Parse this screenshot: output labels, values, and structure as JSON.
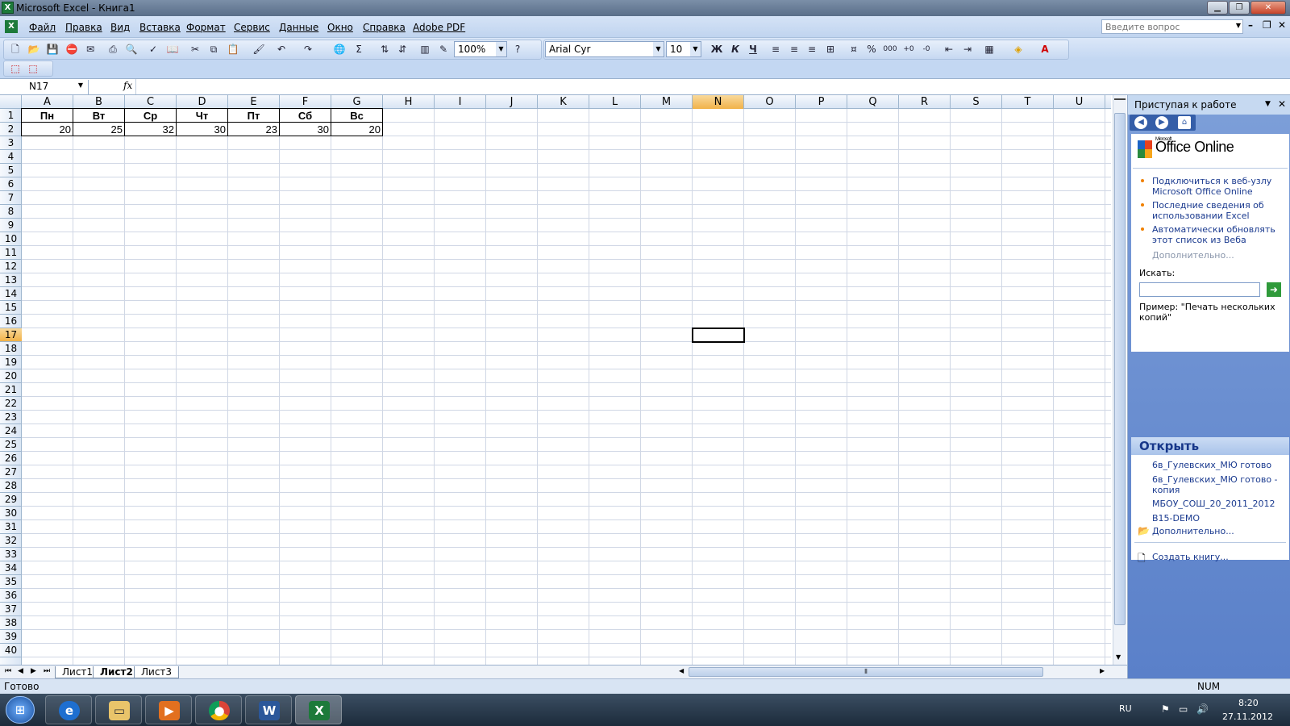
{
  "window": {
    "title": "Microsoft Excel - Книга1"
  },
  "menu": {
    "items": [
      "Файл",
      "Правка",
      "Вид",
      "Вставка",
      "Формат",
      "Сервис",
      "Данные",
      "Окно",
      "Справка",
      "Adobe PDF"
    ],
    "ask_placeholder": "Введите вопрос"
  },
  "toolbar": {
    "zoom": "100%",
    "font_name": "Arial Cyr",
    "font_size": "10"
  },
  "formula_bar": {
    "name_box": "N17",
    "fx": "fx",
    "formula": ""
  },
  "columns": [
    "A",
    "B",
    "C",
    "D",
    "E",
    "F",
    "G",
    "H",
    "I",
    "J",
    "K",
    "L",
    "M",
    "N",
    "O",
    "P",
    "Q",
    "R",
    "S",
    "T",
    "U"
  ],
  "selected_column": "N",
  "selected_row": 17,
  "row_count": 40,
  "sheet": {
    "headers": [
      "Пн",
      "Вт",
      "Ср",
      "Чт",
      "Пт",
      "Сб",
      "Вс"
    ],
    "values": [
      "20",
      "25",
      "32",
      "30",
      "23",
      "30",
      "20"
    ]
  },
  "sheet_tabs": [
    "Лист1",
    "Лист2",
    "Лист3"
  ],
  "active_tab": "Лист2",
  "status": {
    "left": "Готово",
    "num": "NUM"
  },
  "task_pane": {
    "title": "Приступая к работе",
    "logo_small": "Microsoft",
    "logo": "Office Online",
    "links": [
      "Подключиться к веб-узлу Microsoft Office Online",
      "Последние сведения об использовании Excel",
      "Автоматически обновлять этот список из Веба"
    ],
    "more1": "Дополнительно...",
    "search_label": "Искать:",
    "search_value": "",
    "example": "Пример:  \"Печать нескольких копий\"",
    "open_header": "Открыть",
    "open_files": [
      "6в_Гулевских_МЮ готово",
      "6в_Гулевских_МЮ готово - копия",
      "МБОУ_СОШ_20_2011_2012",
      "B15-DEMO"
    ],
    "more2": "Дополнительно...",
    "create": "Создать книгу..."
  },
  "taskbar": {
    "lang": "RU",
    "time": "8:20",
    "date": "27.11.2012"
  }
}
